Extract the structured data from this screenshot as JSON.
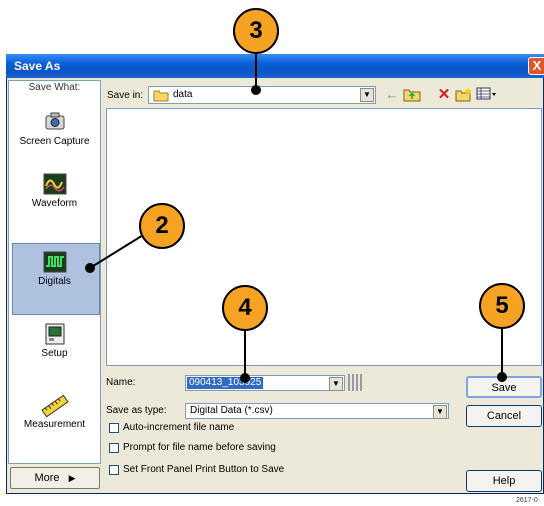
{
  "window": {
    "title": "Save As",
    "close_glyph": "X"
  },
  "save_what": {
    "label": "Save What:",
    "items": [
      {
        "label": "Screen Capture",
        "icon": "camera-icon"
      },
      {
        "label": "Waveform",
        "icon": "waveform-icon"
      },
      {
        "label": "Digitals",
        "icon": "digitals-icon",
        "selected": true
      },
      {
        "label": "Setup",
        "icon": "setup-icon"
      },
      {
        "label": "Measurement",
        "icon": "ruler-icon"
      }
    ],
    "more_label": "More"
  },
  "save_in": {
    "label": "Save in:",
    "value": "data"
  },
  "toolbar": [
    "back-arrow-icon",
    "up-folder-icon",
    "delete-icon",
    "new-folder-icon",
    "views-icon"
  ],
  "form": {
    "name_label": "Name:",
    "name_value": "090413_103925",
    "type_label": "Save as type:",
    "type_value": "Digital Data (*.csv)",
    "checkboxes": [
      {
        "label": "Auto-increment file name",
        "checked": false
      },
      {
        "label": "Prompt for file name before saving",
        "checked": false
      },
      {
        "label": "Set Front Panel Print Button to Save",
        "checked": false
      }
    ]
  },
  "buttons": {
    "save": "Save",
    "cancel": "Cancel",
    "help": "Help"
  },
  "callouts": [
    "2",
    "3",
    "4",
    "5"
  ],
  "figure_code": "2617-0"
}
